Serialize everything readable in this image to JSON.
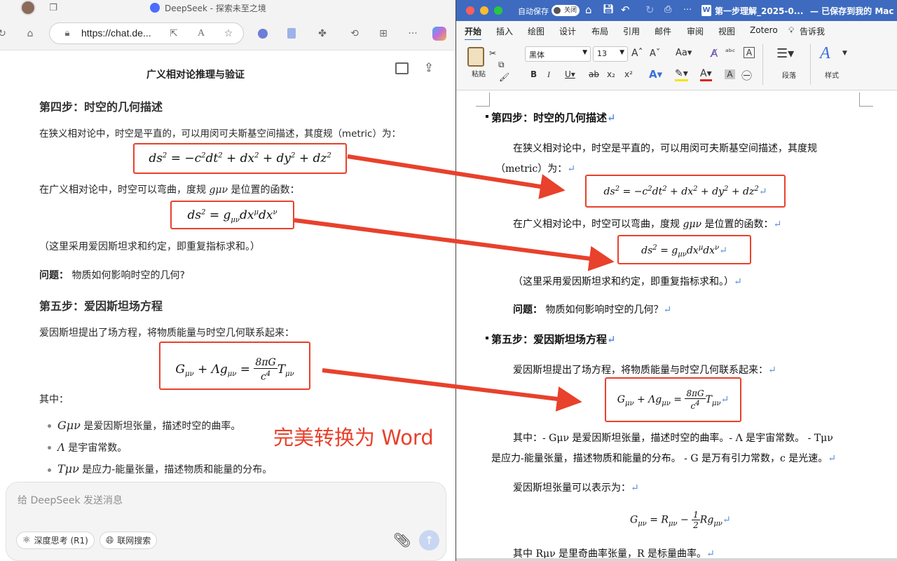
{
  "browser": {
    "tab_title": "DeepSeek - 探索未至之境",
    "url": "https://chat.de...",
    "font_zoom_label": "A",
    "more_label": "···"
  },
  "chat": {
    "title": "广义相对论推理与验证",
    "step4_heading": "第四步：时空的几何描述",
    "para_special": "在狭义相对论中，时空是平直的，可以用闵可夫斯基空间描述，其度规（metric）为：",
    "para_general_1": "在广义相对论中，时空可以弯曲，度规",
    "para_general_sym": "gμν",
    "para_general_2": "是位置的函数：",
    "para_einstein_sum": "（这里采用爱因斯坦求和约定，即重复指标求和。）",
    "question_label": "问题：",
    "question_text": "物质如何影响时空的几何?",
    "step5_heading": "第五步：爱因斯坦场方程",
    "para_field": "爱因斯坦提出了场方程，将物质能量与时空几何联系起来：",
    "where_label": "其中：",
    "bullets": [
      {
        "sym": "Gμν",
        "text": "是爱因斯坦张量，描述时空的曲率。"
      },
      {
        "sym": "Λ",
        "text": "是宇宙常数。"
      },
      {
        "sym": "Tμν",
        "text": "是应力-能量张量，描述物质和能量的分布。"
      }
    ],
    "overlay_text": "完美转换为 Word",
    "input_placeholder": "给 DeepSeek 发送消息",
    "deep_think_label": "深度思考 (R1)",
    "web_search_label": "联网搜索",
    "send_icon": "arrow-up-icon"
  },
  "word": {
    "autosave_label": "自动保存",
    "autosave_state": "关闭",
    "doc_title": "第一步理解_2025-0...",
    "save_status": "— 已保存到我的 Mac",
    "tabs": [
      "开始",
      "插入",
      "绘图",
      "设计",
      "布局",
      "引用",
      "邮件",
      "审阅",
      "视图",
      "Zotero"
    ],
    "tell_me_label": "告诉我",
    "font_name": "黑体",
    "font_size": "13",
    "paste_label": "粘贴",
    "paragraph_label": "段落",
    "styles_label": "样式",
    "doc": {
      "step4_heading": "第四步：时空的几何描述",
      "para_special_1": "在狭义相对论中，时空是平直的，可以用闵可夫斯基空间描述，其度规",
      "para_special_2": "（metric）为：",
      "para_general_1": "在广义相对论中，时空可以弯曲，度规",
      "para_general_sym": "gμν",
      "para_general_2": "是位置的函数：",
      "para_einstein_sum": "（这里采用爱因斯坦求和约定，即重复指标求和。）",
      "question_label": "问题：",
      "question_text": "物质如何影响时空的几何？",
      "step5_heading": "第五步：爱因斯坦场方程",
      "para_field": "爱因斯坦提出了场方程，将物质能量与时空几何联系起来：",
      "where_line_1": "其中：- Gμν 是爱因斯坦张量，描述时空的曲率。- Λ 是宇宙常数。 - Tμν",
      "where_line_2": "是应力-能量张量，描述物质和能量的分布。 - G 是万有引力常数，c 是光速。",
      "tensor_intro": "爱因斯坦张量可以表示为：",
      "bottom_line": "其中 Rμν 是里奇曲率张量，R 是标量曲率。"
    }
  },
  "colors": {
    "annotation_red": "#e8412c",
    "word_blue": "#3e6bbf"
  }
}
